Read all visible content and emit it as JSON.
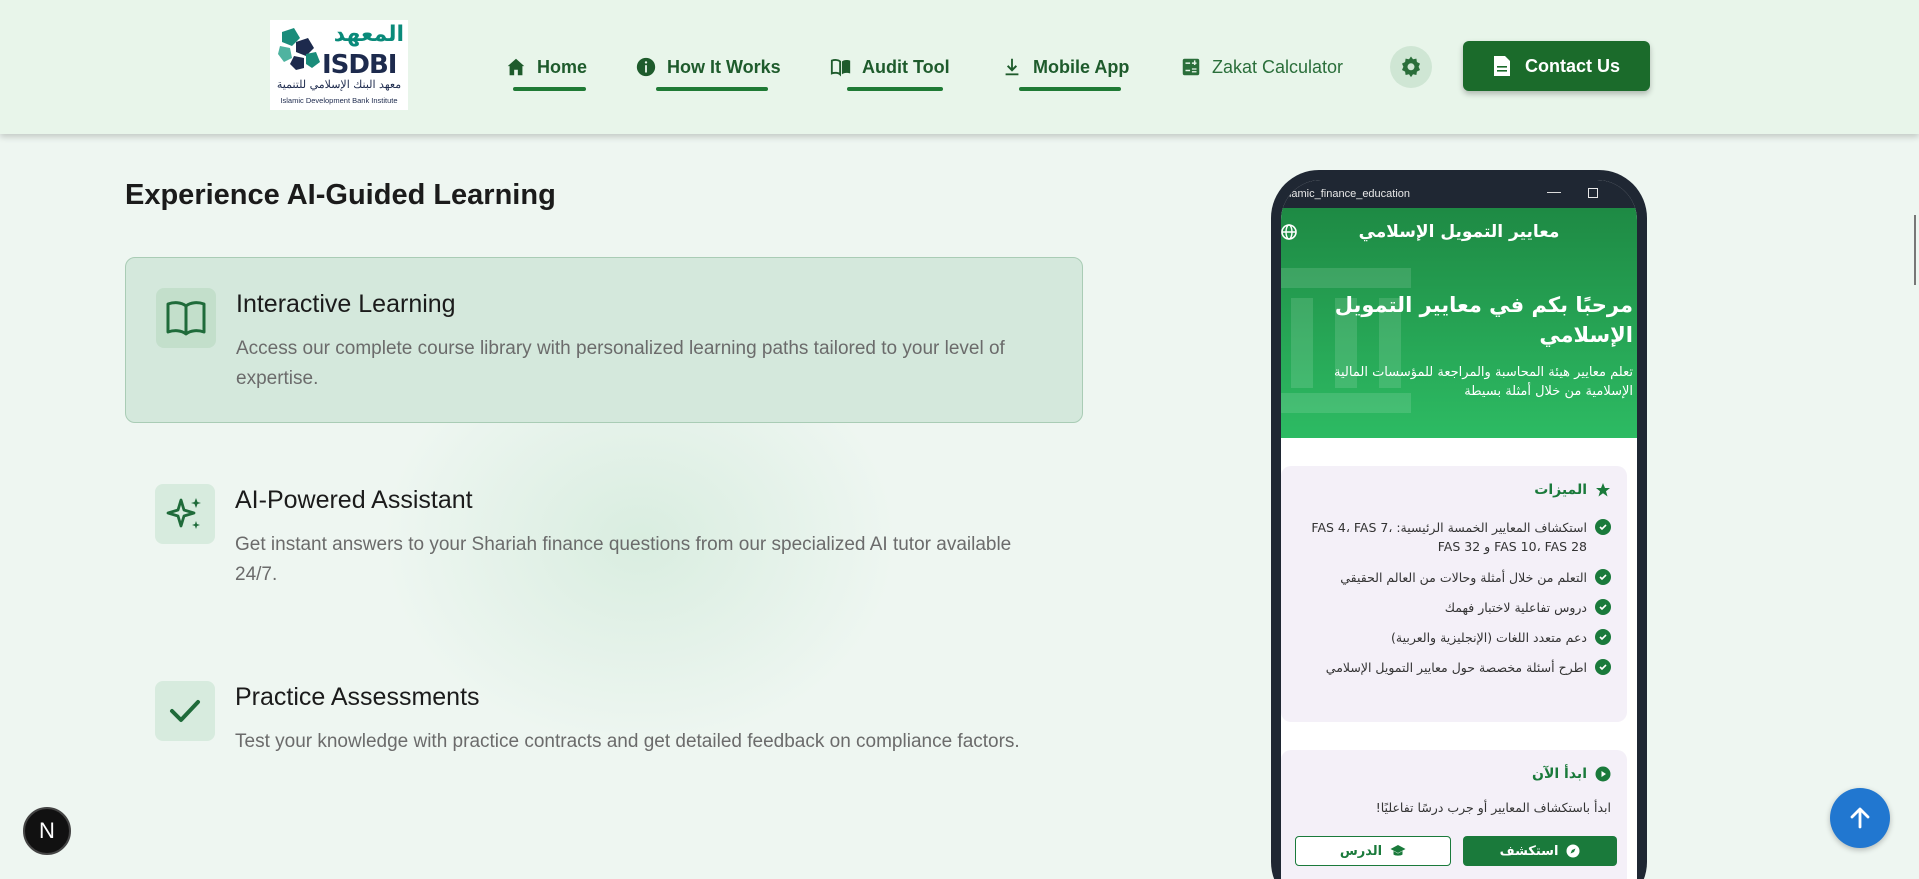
{
  "header": {
    "logo": {
      "arabic": "المعهد",
      "name": "ISDBI",
      "arabic_full": "معهد البنك الإسلامي للتنمية",
      "english": "Islamic Development Bank Institute"
    },
    "nav": [
      {
        "label": "Home",
        "icon": "home-icon",
        "active": true
      },
      {
        "label": "How It Works",
        "icon": "info-icon",
        "active": true
      },
      {
        "label": "Audit Tool",
        "icon": "book-icon",
        "active": true
      },
      {
        "label": "Mobile App",
        "icon": "download-icon",
        "active": true
      },
      {
        "label": "Zakat Calculator",
        "icon": "calculator-icon",
        "active": false
      }
    ],
    "settings_icon": "gear-icon",
    "contact_label": "Contact Us"
  },
  "main": {
    "title": "Experience AI-Guided Learning",
    "features": [
      {
        "title": "Interactive Learning",
        "desc": "Access our complete course library with personalized learning paths tailored to your level of expertise.",
        "icon": "open-book-icon"
      },
      {
        "title": "AI-Powered Assistant",
        "desc": "Get instant answers to your Shariah finance questions from our specialized AI tutor available 24/7.",
        "icon": "sparkles-icon"
      },
      {
        "title": "Practice Assessments",
        "desc": "Test your knowledge with practice contracts and get detailed feedback on compliance factors.",
        "icon": "check-icon"
      }
    ]
  },
  "phone": {
    "window_title": "islamic_finance_education",
    "app_title": "معايير التمويل الإسلامي",
    "hero_title": "مرحبًا بكم في معايير التمويل الإسلامي",
    "hero_sub": "تعلم معايير هيئة المحاسبة والمراجعة للمؤسسات المالية الإسلامية من خلال أمثلة بسيطة",
    "features_card": {
      "title": "الميزات",
      "items": [
        "استكشاف المعايير الخمسة الرئيسية: FAS 4، FAS 7، FAS 10، FAS 28 و FAS 32",
        "التعلم من خلال أمثلة وحالات من العالم الحقيقي",
        "دروس تفاعلية لاختبار فهمك",
        "دعم متعدد اللغات (الإنجليزية والعربية)",
        "اطرح أسئلة مخصصة حول معايير التمويل الإسلامي"
      ]
    },
    "start_card": {
      "title": "ابدأ الآن",
      "desc": "ابدأ باستكشاف المعايير أو جرب درسًا تفاعليًا!",
      "explore_label": "استكشف",
      "lesson_label": "الدرس"
    }
  },
  "floating": {
    "next_badge": "N",
    "scroll_top_icon": "arrow-up-icon"
  },
  "colors": {
    "primary": "#1b6b2b",
    "accent": "#2dbb63",
    "background": "#eef6f1",
    "scroll_button": "#2177d0"
  }
}
